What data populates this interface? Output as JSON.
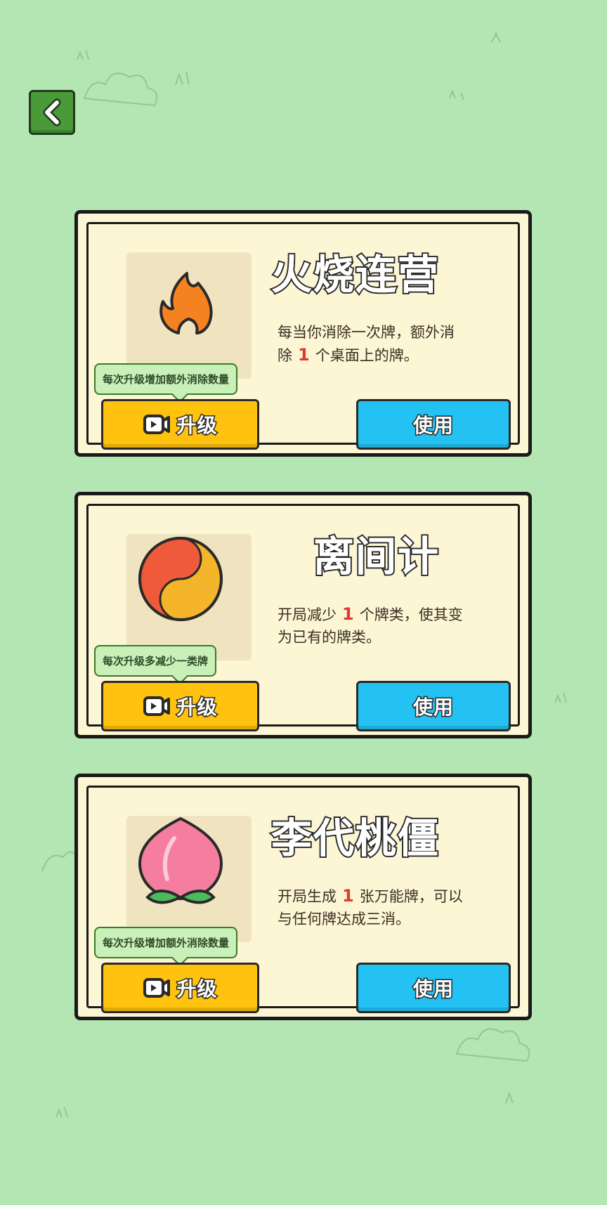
{
  "back_button": {
    "icon": "chevron-left-icon"
  },
  "cards": [
    {
      "title": "火烧连营",
      "icon": "fire-icon",
      "desc_pre": "每当你消除一次牌，额外消除",
      "desc_num": "1",
      "desc_post": "个桌面上的牌。",
      "tooltip": "每次升级增加额外消除数量",
      "upgrade_label": "升级",
      "use_label": "使用"
    },
    {
      "title": "离间计",
      "icon": "yin-yang-icon",
      "desc_pre": "开局减少",
      "desc_num": "1",
      "desc_post": "个牌类，使其变为已有的牌类。",
      "tooltip": "每次升级多减少一类牌",
      "upgrade_label": "升级",
      "use_label": "使用"
    },
    {
      "title": "李代桃僵",
      "icon": "peach-icon",
      "desc_pre": "开局生成",
      "desc_num": "1",
      "desc_post": "张万能牌，可以与任何牌达成三消。",
      "tooltip": "每次升级增加额外消除数量",
      "upgrade_label": "升级",
      "use_label": "使用"
    }
  ],
  "colors": {
    "background": "#b4e6b4",
    "upgrade": "#ffc20e",
    "use": "#23c2f2",
    "highlight_number": "#e03a2e"
  }
}
